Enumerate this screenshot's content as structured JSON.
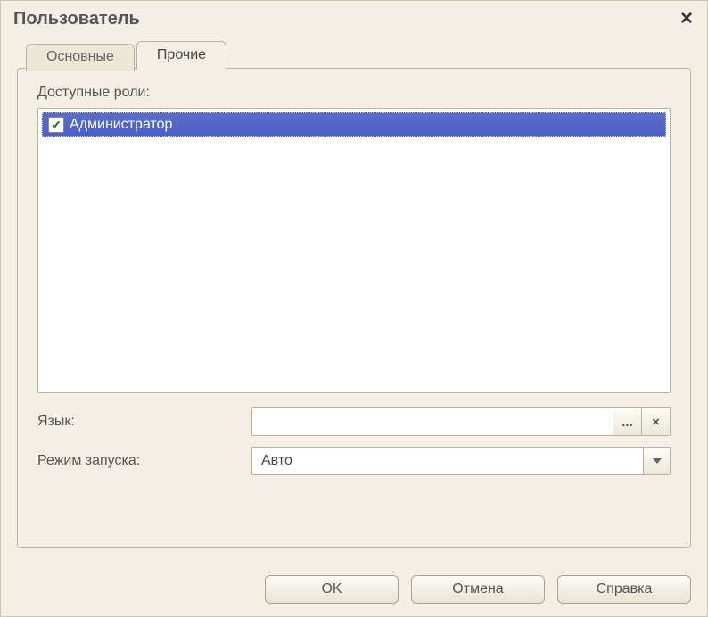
{
  "window": {
    "title": "Пользователь"
  },
  "tabs": {
    "main": "Основные",
    "other": "Прочие"
  },
  "roles": {
    "label": "Доступные роли:",
    "items": [
      {
        "label": "Администратор",
        "checked": true,
        "selected": true
      }
    ]
  },
  "language": {
    "label": "Язык:",
    "value": "",
    "ellipsis": "...",
    "clear": "×"
  },
  "launch_mode": {
    "label": "Режим запуска:",
    "value": "Авто"
  },
  "buttons": {
    "ok": "OK",
    "cancel": "Отмена",
    "help": "Справка"
  }
}
